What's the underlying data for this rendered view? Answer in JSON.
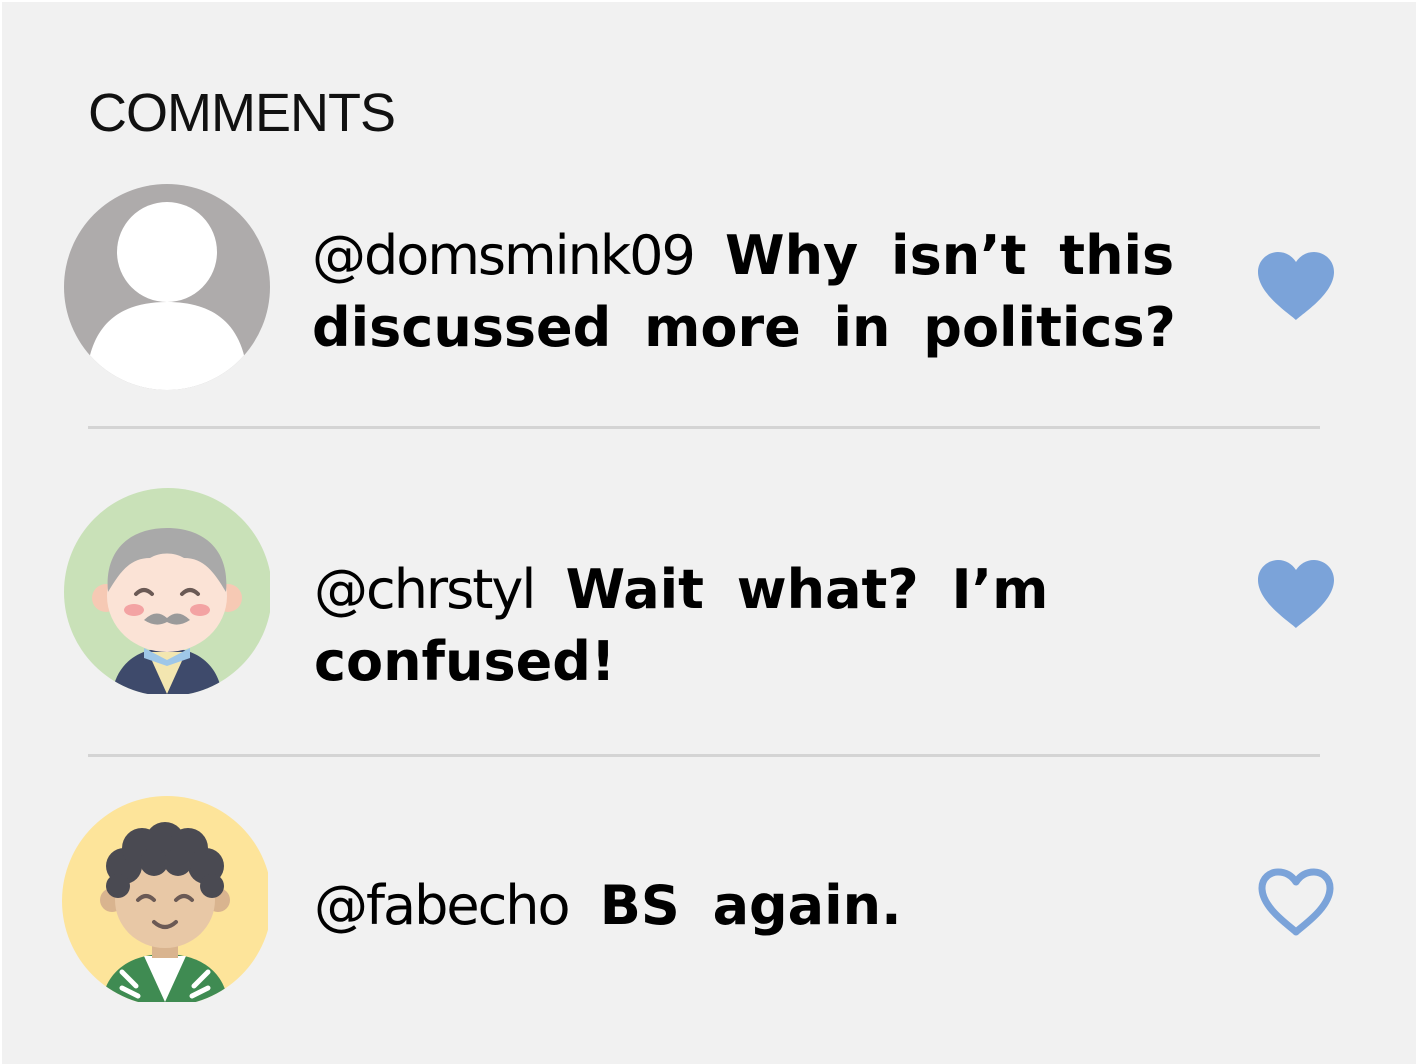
{
  "section_title": "COMMENTS",
  "colors": {
    "like_blue": "#7ba3d9",
    "panel_bg": "#f1f1f1",
    "divider": "#d4d4d4"
  },
  "comments": [
    {
      "username": "@domsmink09",
      "message": "Why isn’t this discussed more in politics?",
      "avatar": "default-user-avatar",
      "liked": true
    },
    {
      "username": "@chrstyl",
      "message": "Wait what? I’m confused!",
      "avatar": "old-man-avatar",
      "liked": true
    },
    {
      "username": "@fabecho",
      "message": "BS again.",
      "avatar": "curly-hair-man-avatar",
      "liked": false
    }
  ]
}
